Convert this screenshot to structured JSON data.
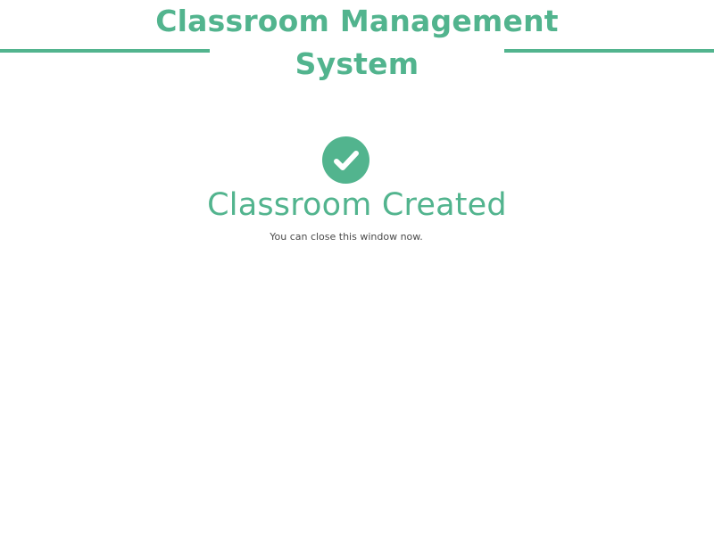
{
  "header": {
    "title": "Classroom Management System"
  },
  "status": {
    "icon": "check-circle-icon",
    "title": "Classroom Created",
    "message": "You can close this window now."
  },
  "colors": {
    "accent": "#52b48e",
    "message_text": "#4b4b4b",
    "background": "#ffffff"
  }
}
